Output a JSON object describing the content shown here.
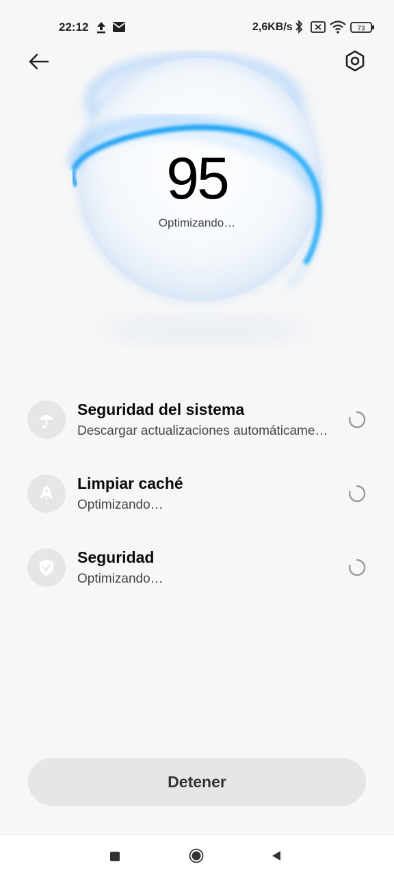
{
  "status_bar": {
    "time": "22:12",
    "net_speed": "2,6KB/s",
    "battery": "73",
    "icons": [
      "upload-icon",
      "mail-icon",
      "bluetooth-icon",
      "no-sim-icon",
      "wifi-icon",
      "battery-icon"
    ]
  },
  "header": {
    "back_icon": "arrow-left-icon",
    "settings_icon": "settings-hexagon-icon"
  },
  "score": {
    "value": "95",
    "status": "Optimizando…"
  },
  "tasks": [
    {
      "title": "Seguridad del sistema",
      "subtitle": "Descargar actualizaciones automáticame…",
      "icon": "umbrella-icon"
    },
    {
      "title": "Limpiar caché",
      "subtitle": "Optimizando…",
      "icon": "rocket-icon"
    },
    {
      "title": "Seguridad",
      "subtitle": "Optimizando…",
      "icon": "shield-check-icon"
    }
  ],
  "stop_button": {
    "label": "Detener"
  },
  "colors": {
    "accent_blue": "#1e9bf0",
    "background": "#f7f7f7",
    "button_bg": "#e6e6e6"
  }
}
